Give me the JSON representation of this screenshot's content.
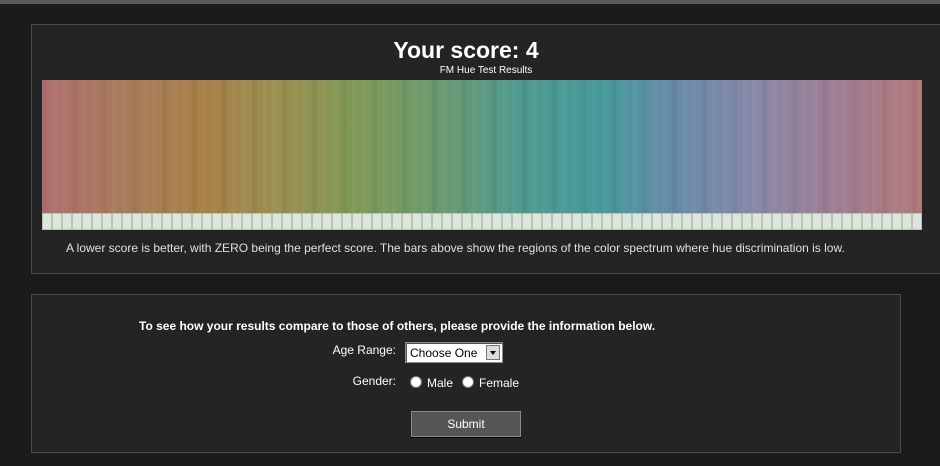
{
  "results": {
    "title": "Your score: 4",
    "subtitle": "FM Hue Test Results",
    "note": "A lower score is better, with ZERO being the perfect score. The bars above show the regions of the color spectrum where hue discrimination is low."
  },
  "spectrum": {
    "gradient_colors": [
      "#b07070",
      "#a87a5a",
      "#a88048",
      "#9a9050",
      "#7d9a58",
      "#6a9a70",
      "#4f9a90",
      "#46999a",
      "#6a8aaa",
      "#8a88a8",
      "#a07c90",
      "#b07a7a"
    ],
    "tick_count": 88
  },
  "compare": {
    "prompt": "To see how your results compare to those of others, please provide the information below.",
    "age_label": "Age Range:",
    "age_value": "Choose One",
    "gender_label": "Gender:",
    "male_label": "Male",
    "female_label": "Female",
    "submit_label": "Submit"
  }
}
